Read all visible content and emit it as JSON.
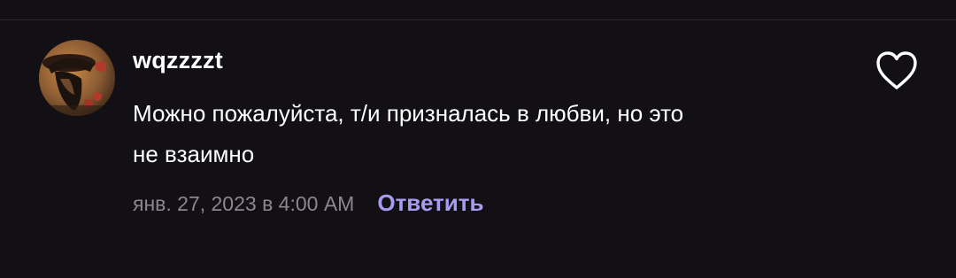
{
  "comment": {
    "username": "wqzzzzt",
    "text_line_1": "Можно пожалуйста, т/и призналась в любви, но это",
    "text_line_2": "не взаимно",
    "timestamp": "янв. 27, 2023 в 4:00 AM",
    "reply_label": "Ответить",
    "avatar_icon": "user-avatar-anime-portrait",
    "like_icon": "heart-outline-icon"
  },
  "colors": {
    "background": "#121015",
    "text": "#ffffff",
    "muted": "#8a8790",
    "accent": "#a99cf0"
  }
}
